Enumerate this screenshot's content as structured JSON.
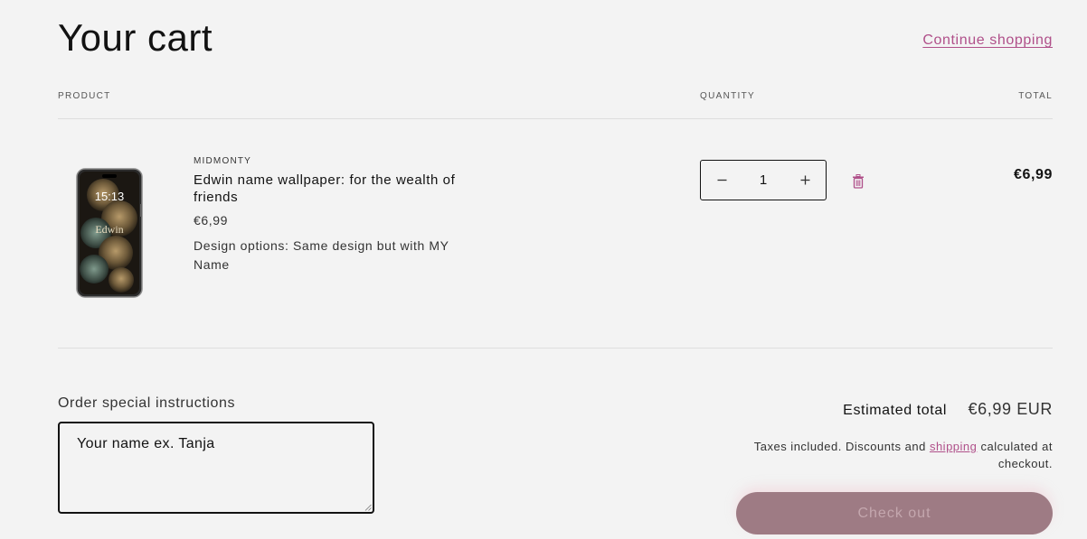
{
  "header": {
    "title": "Your cart",
    "continue_label": "Continue shopping"
  },
  "columns": {
    "product": "PRODUCT",
    "quantity": "QUANTITY",
    "total": "TOTAL"
  },
  "item": {
    "vendor": "MIDMONTY",
    "name": "Edwin name wallpaper: for the wealth of friends",
    "price": "€6,99",
    "option": "Design options: Same design but with MY Name",
    "quantity": "1",
    "line_total": "€6,99",
    "image": {
      "clock": "15:13",
      "lockscreen_text": "Edwin"
    },
    "decrease_icon": "minus-icon",
    "increase_icon": "plus-icon",
    "remove_icon": "trash-icon"
  },
  "instructions": {
    "label": "Order special instructions",
    "value": "Your name ex. Tanja"
  },
  "summary": {
    "estimated_label": "Estimated total",
    "estimated_value": "€6,99 EUR",
    "tax_before": "Taxes included. Discounts and ",
    "tax_link": "shipping",
    "tax_after": " calculated at checkout.",
    "checkout_label": "Check out"
  },
  "colors": {
    "accent": "#b0508a",
    "checkout_bg": "#9e7b84",
    "background": "#f3f3f3"
  }
}
